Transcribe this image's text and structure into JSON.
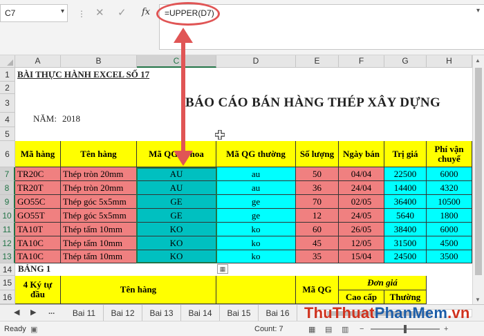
{
  "name_box": "C7",
  "formula": "=UPPER(D7)",
  "columns": [
    "A",
    "B",
    "C",
    "D",
    "E",
    "F",
    "G",
    "H"
  ],
  "rows": [
    "1",
    "2",
    "3",
    "4",
    "5",
    "6",
    "7",
    "8",
    "9",
    "10",
    "11",
    "12",
    "13",
    "14",
    "15",
    "16"
  ],
  "title": "BÀI THỰC HÀNH EXCEL SỐ 17",
  "report_title": "BÁO CÁO BÁN HÀNG THÉP XÂY DỰNG",
  "year_label": "NĂM:",
  "year_value": "2018",
  "headers": [
    "Mã hàng",
    "Tên hàng",
    "Mã QG in hoa",
    "Mã QG thường",
    "Số lượng",
    "Ngày bán",
    "Trị giá",
    "Phí vận chuyể"
  ],
  "data_rows": [
    [
      "TR20C",
      "Thép tròn 20mm",
      "AU",
      "au",
      "50",
      "04/04",
      "22500",
      "6000"
    ],
    [
      "TR20T",
      "Thép tròn 20mm",
      "AU",
      "au",
      "36",
      "24/04",
      "14400",
      "4320"
    ],
    [
      "GO55C",
      "Thép góc 5x5mm",
      "GE",
      "ge",
      "70",
      "02/05",
      "36400",
      "10500"
    ],
    [
      "GO55T",
      "Thép góc 5x5mm",
      "GE",
      "ge",
      "12",
      "24/05",
      "5640",
      "1800"
    ],
    [
      "TA10T",
      "Thép tấm 10mm",
      "KO",
      "ko",
      "60",
      "26/05",
      "38400",
      "6000"
    ],
    [
      "TA10C",
      "Thép tấm 10mm",
      "KO",
      "ko",
      "45",
      "12/05",
      "31500",
      "4500"
    ],
    [
      "TA10C",
      "Thép tấm 10mm",
      "KO",
      "ko",
      "35",
      "15/04",
      "24500",
      "3500"
    ]
  ],
  "bang1": "BẢNG 1",
  "table2": {
    "ky_tu": "4 Ký tự đầu",
    "ten_hang": "Tên hàng",
    "ma_qg": "Mã QG",
    "don_gia": "Đơn giá",
    "cao_cap": "Cao cấp",
    "thuong": "Thường"
  },
  "sheet_tabs": [
    "Bai 11",
    "Bai 12",
    "Bai 13",
    "Bai 14",
    "Bai 15",
    "Bai 16"
  ],
  "tab_more": "...",
  "status": {
    "ready": "Ready",
    "count": "Count: 7"
  },
  "watermark": {
    "part1": "ThuThuat",
    "part2": "PhanMem",
    "part3": ".vn"
  },
  "colors": {
    "accent": "#217346",
    "red_fill": "#f08080",
    "cyan_fill": "#00ffff",
    "teal_fill": "#00c0c0",
    "header_fill": "#ffff00",
    "annotation": "#e05555"
  }
}
